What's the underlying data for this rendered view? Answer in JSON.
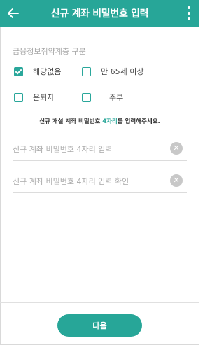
{
  "header": {
    "title": "신규 계좌 비밀번호 입력",
    "back_icon": "arrow-left-icon",
    "menu_icon": "more-vertical-icon",
    "color": "#27a698"
  },
  "vulnerable_section": {
    "label": "금융정보취약계층 구분",
    "options": [
      {
        "label": "해당없음",
        "checked": true
      },
      {
        "label": "만 65세 이상",
        "checked": false
      },
      {
        "label": "은퇴자",
        "checked": false
      },
      {
        "label": "주부",
        "checked": false
      }
    ]
  },
  "hint": {
    "prefix": "신규 개설 계좌 비밀번호 ",
    "highlight": "4자리",
    "suffix": "를 입력해주세요."
  },
  "password_field": {
    "placeholder": "신규 계좌 비밀번호 4자리 입력",
    "value": "",
    "clear_icon": "clear-circle-icon"
  },
  "confirm_field": {
    "placeholder": "신규 계좌 비밀번호 4자리 입력 확인",
    "value": "",
    "clear_icon": "clear-circle-icon"
  },
  "footer": {
    "next_label": "다음"
  }
}
